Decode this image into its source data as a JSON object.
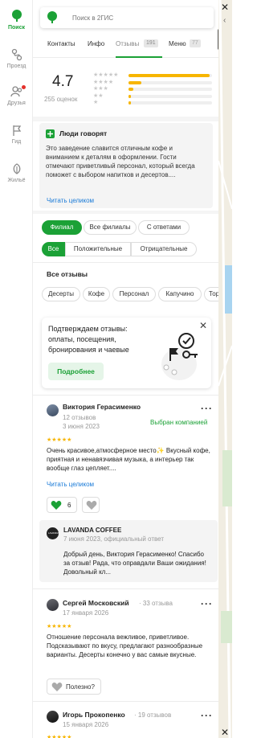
{
  "nav": {
    "items": [
      {
        "label": "Поиск",
        "icon": "leaf-icon"
      },
      {
        "label": "Проезд",
        "icon": "route-icon"
      },
      {
        "label": "Друзья",
        "icon": "friends-icon"
      },
      {
        "label": "Гид",
        "icon": "flag-icon"
      },
      {
        "label": "Жильё",
        "icon": "housing-icon"
      }
    ]
  },
  "search": {
    "placeholder": "Поиск в 2ГИС"
  },
  "tabs": [
    {
      "label": "Контакты"
    },
    {
      "label": "Инфо"
    },
    {
      "label": "Отзывы",
      "count": "191"
    },
    {
      "label": "Меню",
      "count": "77"
    }
  ],
  "rating": {
    "value": "4.7",
    "count_text": "255 оценок",
    "distribution": [
      0.97,
      0.15,
      0.06,
      0.03,
      0.03
    ]
  },
  "people_say": {
    "title": "Люди говорят",
    "text": "Это заведение славится отличным кофе и вниманием к деталям в оформлении. Гости отмечают приветливый персонал, который всегда поможет с выбором напитков и десертов....",
    "link": "Читать целиком"
  },
  "filters": {
    "branch": [
      "Филиал",
      "Все филиалы",
      "С ответами"
    ],
    "sentiment": [
      "Все",
      "Положительные",
      "Отрицательные"
    ]
  },
  "all_reviews": {
    "title": "Все отзывы",
    "tags": [
      "Десерты",
      "Кофе",
      "Персонал",
      "Капучино",
      "Тор"
    ]
  },
  "promo": {
    "text": "Подтверждаем отзывы: оплаты, посещения, бронирования и чаевые",
    "button": "Подробнее"
  },
  "reviews": [
    {
      "author": "Виктория Герасименко",
      "meta": "12 отзывов",
      "date": "3 июня 2023",
      "badge": "Выбран компанией",
      "stars": 5,
      "text": "Очень красивое,атмосферное место✨ Вкусный кофе, приятная и ненавязчивая музыка, а интерьер так вообще глаз цепляет....",
      "link": "Читать целиком",
      "likes": "6",
      "reply": {
        "name": "LAVANDA COFFEE",
        "meta": "7 июня 2023, официальный ответ",
        "text": "Добрый день, Виктория Герасименко! Спасибо за отзыв! Рада, что оправдали Ваши ожидания! Довольный кл..."
      }
    },
    {
      "author": "Сергей Московский",
      "meta": "· 33 отзыва",
      "date": "17 января 2026",
      "stars": 5,
      "text": "Отношение персонала вежливое, приветливое. Подсказывают по вкусу, предлагают разнообразные варианты. Десерты конечно у вас самые вкусные.",
      "useful": "Полезно?"
    },
    {
      "author": "Игорь Прокопенко",
      "meta": "· 19 отзывов",
      "date": "15 января 2026",
      "stars": 5
    }
  ],
  "colors": {
    "brand": "#1ba136",
    "star": "#f7b500"
  }
}
